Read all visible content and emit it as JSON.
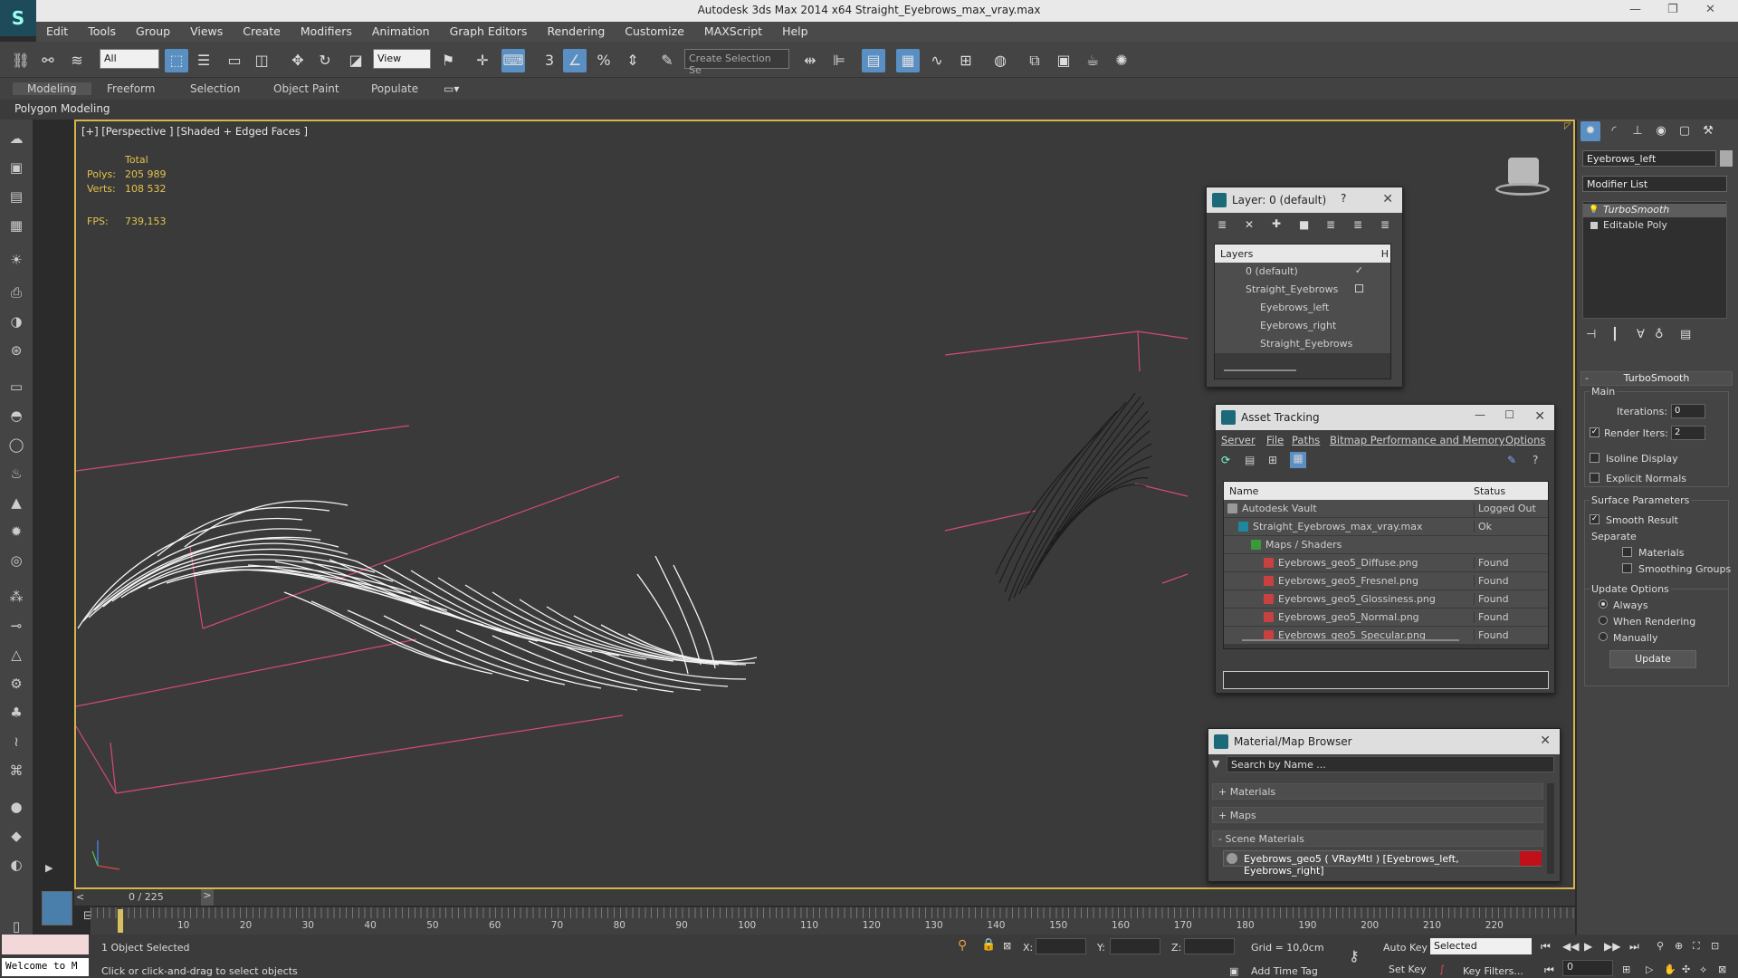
{
  "window": {
    "title": "Autodesk 3ds Max  2014 x64     Straight_Eyebrows_max_vray.max"
  },
  "menu": [
    "Edit",
    "Tools",
    "Group",
    "Views",
    "Create",
    "Modifiers",
    "Animation",
    "Graph Editors",
    "Rendering",
    "Customize",
    "MAXScript",
    "Help"
  ],
  "toolbar": {
    "filter_value": "All",
    "refcoord_value": "View",
    "selection_set_placeholder": "Create Selection Se"
  },
  "ribbon": {
    "tabs": [
      "Modeling",
      "Freeform",
      "Selection",
      "Object Paint",
      "Populate"
    ],
    "sub_label": "Polygon Modeling"
  },
  "viewport": {
    "label": "[+] [Perspective ] [Shaded + Edged Faces ]",
    "stats": {
      "total_label": "Total",
      "polys_label": "Polys:",
      "polys_value": "205 989",
      "verts_label": "Verts:",
      "verts_value": "108 532",
      "fps_label": "FPS:",
      "fps_value": "739,153"
    }
  },
  "layer_dialog": {
    "title": "Layer: 0 (default)",
    "help": "?",
    "header": "Layers",
    "header_col": "H",
    "rows": [
      "0 (default)",
      "Straight_Eyebrows",
      "Eyebrows_left",
      "Eyebrows_right",
      "Straight_Eyebrows"
    ]
  },
  "asset_tracking": {
    "title": "Asset Tracking",
    "menu": [
      "Server",
      "File",
      "Paths",
      "Bitmap Performance and Memory",
      "Options"
    ],
    "col_name": "Name",
    "col_status": "Status",
    "rows": [
      {
        "name": "Autodesk Vault",
        "status": "Logged Out ..."
      },
      {
        "name": "Straight_Eyebrows_max_vray.max",
        "status": "Ok"
      },
      {
        "name": "Maps / Shaders",
        "status": ""
      },
      {
        "name": "Eyebrows_geo5_Diffuse.png",
        "status": "Found"
      },
      {
        "name": "Eyebrows_geo5_Fresnel.png",
        "status": "Found"
      },
      {
        "name": "Eyebrows_geo5_Glossiness.png",
        "status": "Found"
      },
      {
        "name": "Eyebrows_geo5_Normal.png",
        "status": "Found"
      },
      {
        "name": "Eyebrows_geo5_Specular.png",
        "status": "Found"
      }
    ]
  },
  "material_browser": {
    "title": "Material/Map Browser",
    "search_placeholder": "Search by Name ...",
    "groups": [
      "+ Materials",
      "+ Maps",
      "- Scene Materials"
    ],
    "scene_material": "Eyebrows_geo5 ( VRayMtl ) [Eyebrows_left, Eyebrows_right]"
  },
  "command_panel": {
    "object_name": "Eyebrows_left",
    "modifier_list": "Modifier List",
    "stack": [
      "TurboSmooth",
      "Editable Poly"
    ],
    "rollout_title": "TurboSmooth",
    "main": "Main",
    "iterations_label": "Iterations:",
    "iterations_value": "0",
    "render_iters_label": "Render Iters:",
    "render_iters_value": "2",
    "isoline": "Isoline Display",
    "explicit_normals": "Explicit Normals",
    "surface_params": "Surface Parameters",
    "smooth_result": "Smooth Result",
    "separate": "Separate",
    "materials": "Materials",
    "smoothing_groups": "Smoothing Groups",
    "update_options": "Update Options",
    "always": "Always",
    "when_rendering": "When Rendering",
    "manually": "Manually",
    "update_btn": "Update"
  },
  "timeline": {
    "frame": "0 / 225",
    "ticks": [
      "10",
      "20",
      "30",
      "40",
      "50",
      "60",
      "70",
      "80",
      "90",
      "100",
      "110",
      "120",
      "130",
      "140",
      "150",
      "160",
      "170",
      "180",
      "190",
      "200",
      "210",
      "220"
    ]
  },
  "status": {
    "welcome": "Welcome to M",
    "selected": "1 Object Selected",
    "prompt": "Click or click-and-drag to select objects",
    "x": "X:",
    "y": "Y:",
    "z": "Z:",
    "grid": "Grid = 10,0cm",
    "add_time_tag": "Add Time Tag",
    "auto_key": "Auto Key",
    "set_key": "Set Key",
    "key_mode": "Selected",
    "key_filters": "Key Filters...",
    "frame_value": "0"
  },
  "colors": {
    "accent": "#5a8fc4",
    "viewport_border": "#d8b44a",
    "stats": "#e4c34a",
    "material_swatch": "#c0101a"
  }
}
